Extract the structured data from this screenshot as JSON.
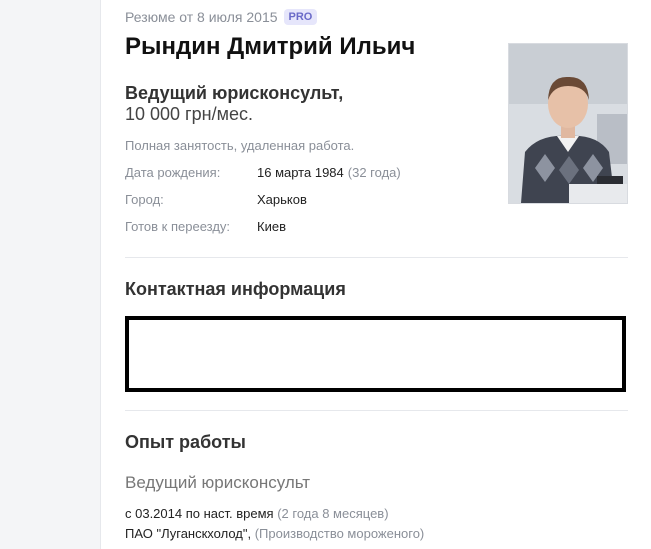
{
  "resume": {
    "date_label": "Резюме от 8 июля 2015",
    "pro_badge": "PRO",
    "name": "Рындин Дмитрий Ильич",
    "position": "Ведущий юрисконсульт,",
    "salary": "10 000 грн/мес.",
    "employment": "Полная занятость, удаленная работа."
  },
  "info": {
    "birth": {
      "label": "Дата рождения:",
      "value": "16 марта 1984",
      "age": "(32 года)"
    },
    "city": {
      "label": "Город:",
      "value": "Харьков"
    },
    "relocation": {
      "label": "Готов к переезду:",
      "value": "Киев"
    }
  },
  "sections": {
    "contacts_title": "Контактная информация",
    "experience_title": "Опыт работы"
  },
  "experience": {
    "job_title": "Ведущий юрисконсульт",
    "period": "с 03.2014 по наст. время",
    "duration": "(2 года 8 месяцев)",
    "company": "ПАО \"Луганскхолод\",",
    "industry": "(Производство мороженого)"
  }
}
